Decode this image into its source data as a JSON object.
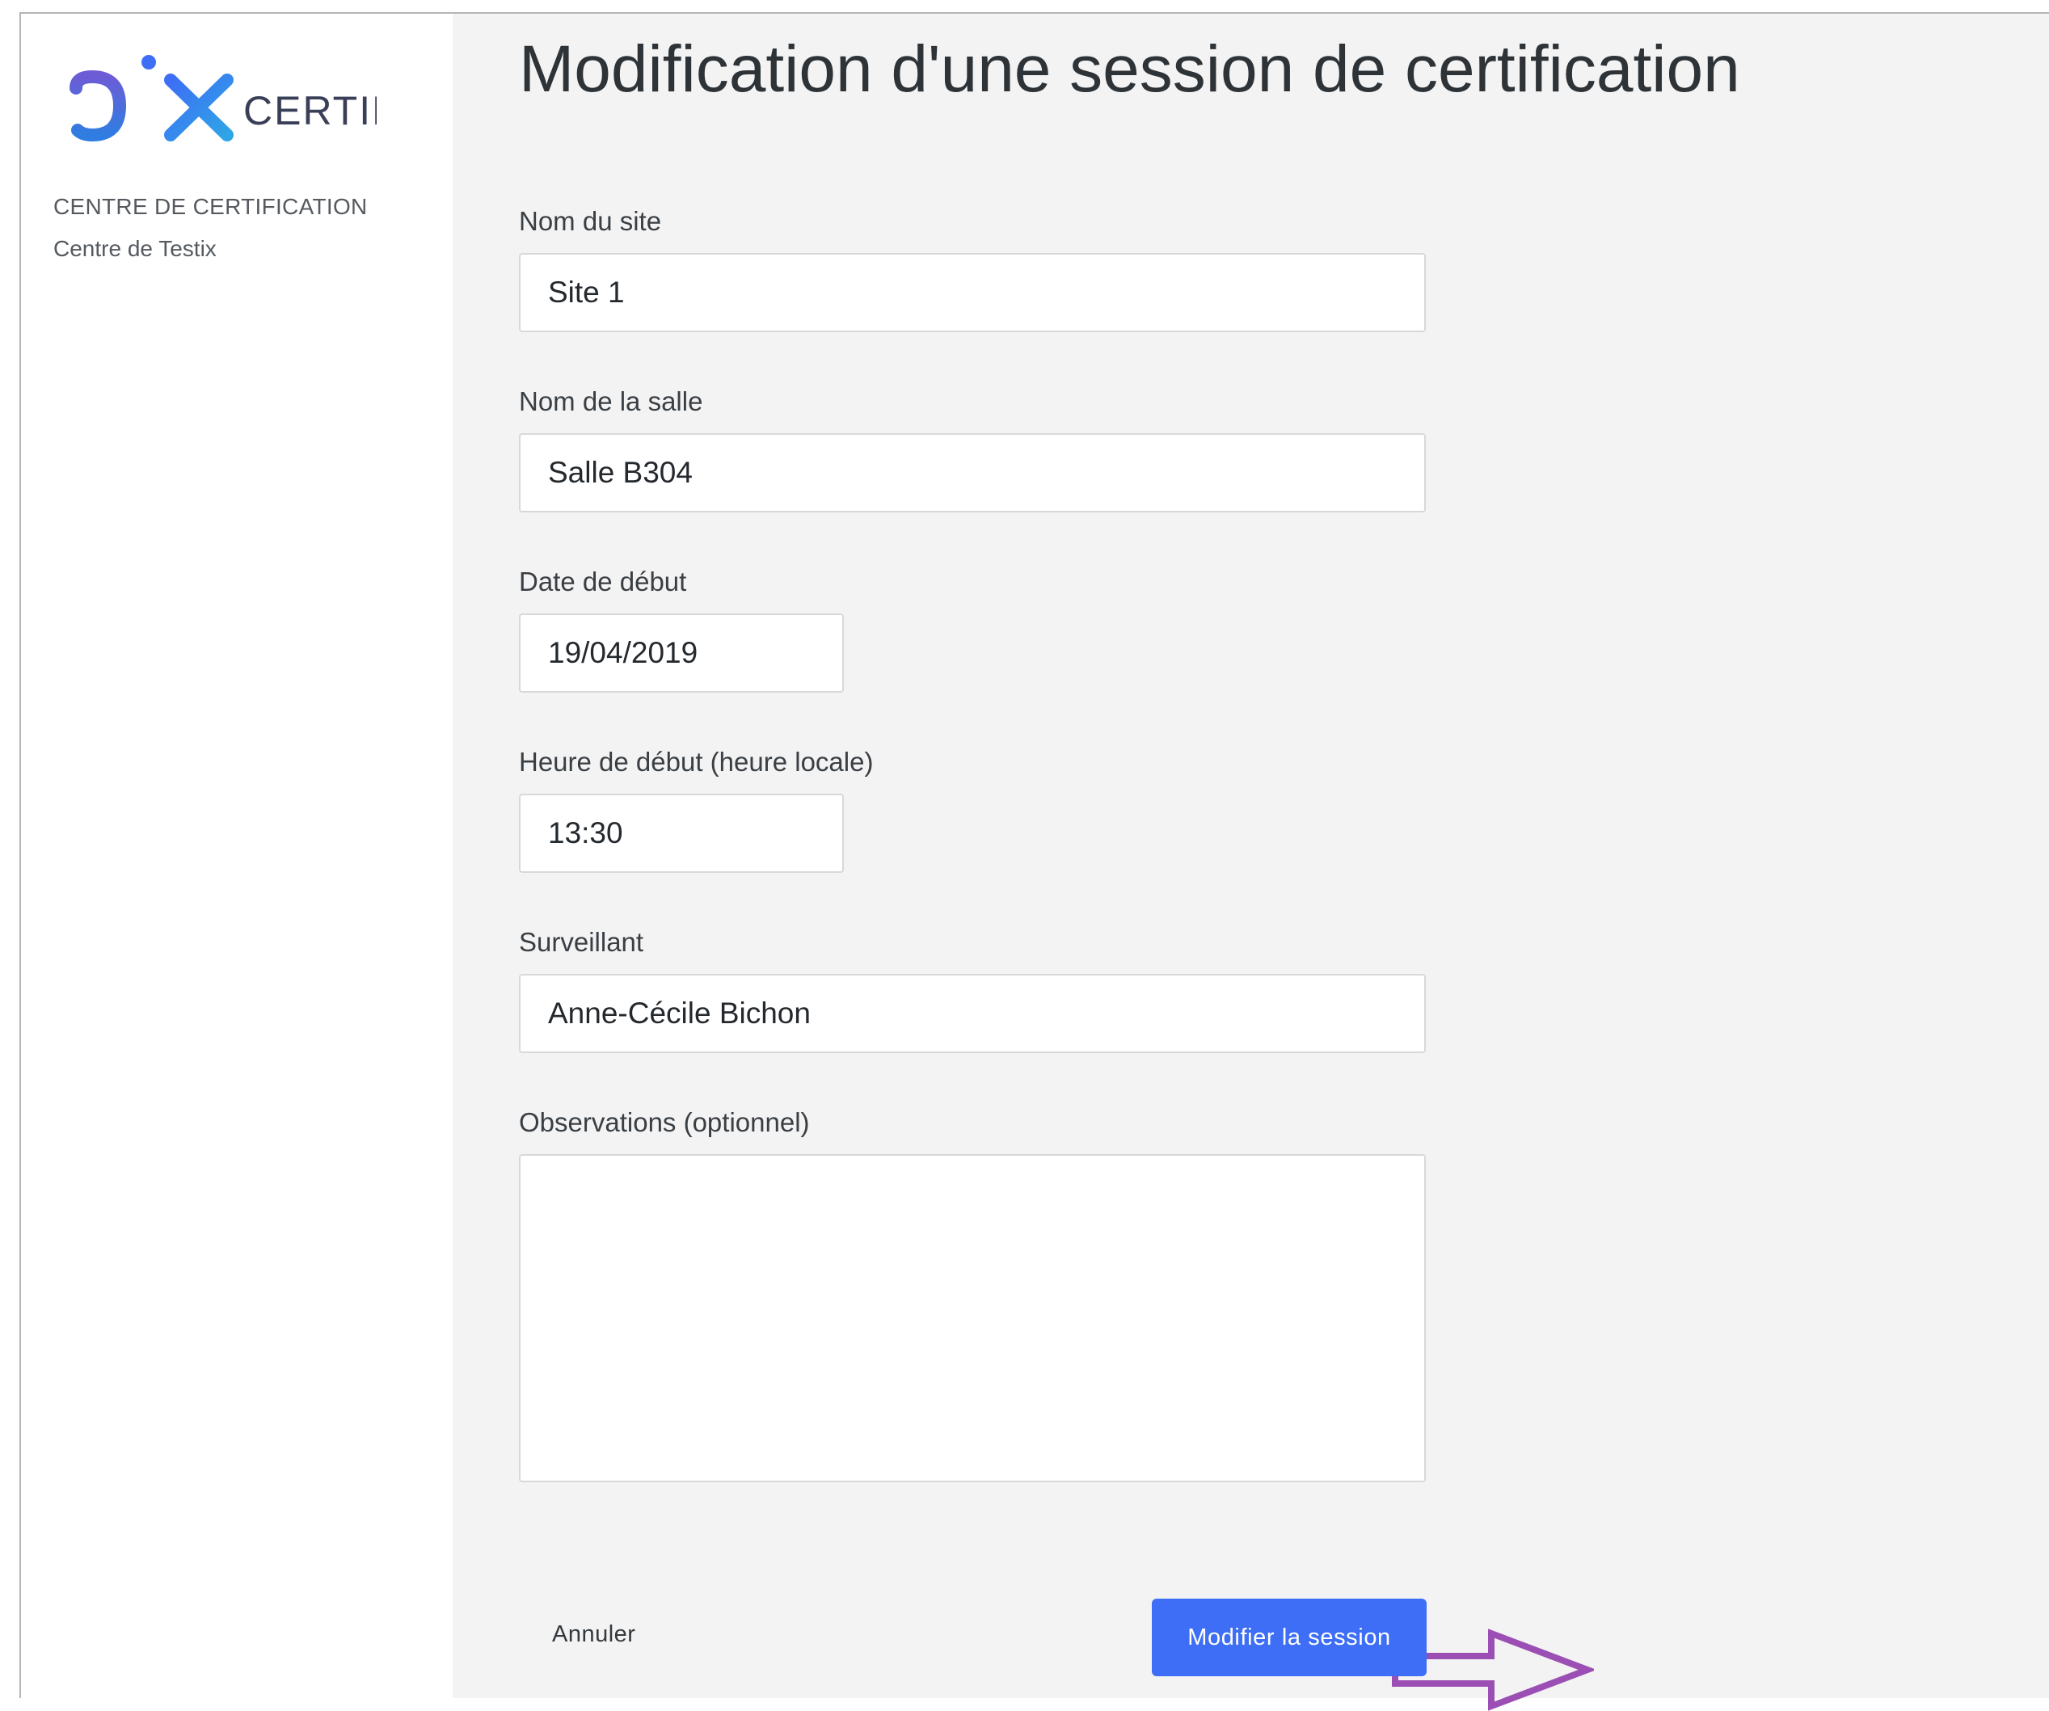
{
  "brand": {
    "logo_text": "pix",
    "logo_suffix": "CERTIF",
    "colors": {
      "blue": "#3d6ef5",
      "purple": "#8a4fc7",
      "annotation_arrow": "#9b4fb4"
    }
  },
  "sidebar": {
    "center_heading": "CENTRE DE CERTIFICATION",
    "center_name": "Centre de Testix"
  },
  "page": {
    "title": "Modification d'une session de certification"
  },
  "form": {
    "site": {
      "label": "Nom du site",
      "value": "Site 1"
    },
    "room": {
      "label": "Nom de la salle",
      "value": "Salle B304"
    },
    "date": {
      "label": "Date de début",
      "value": "19/04/2019"
    },
    "time": {
      "label": "Heure de début (heure locale)",
      "value": "13:30"
    },
    "examiner": {
      "label": "Surveillant",
      "value": "Anne-Cécile Bichon"
    },
    "observations": {
      "label": "Observations (optionnel)",
      "value": ""
    }
  },
  "actions": {
    "cancel_label": "Annuler",
    "submit_label": "Modifier la session"
  }
}
